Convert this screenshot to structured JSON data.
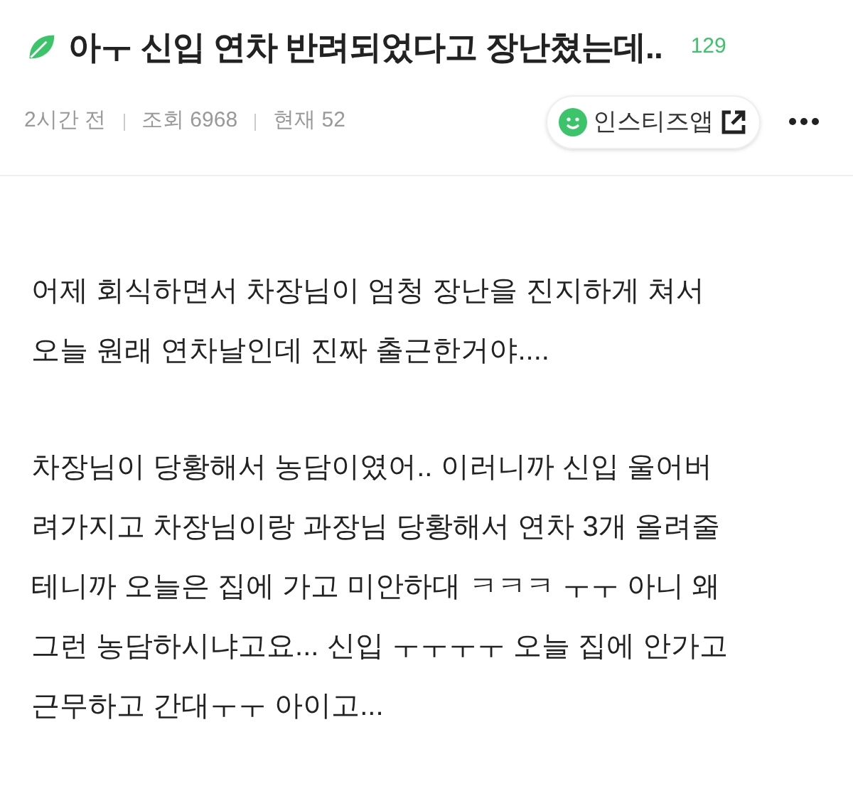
{
  "header": {
    "title": "아ㅜ 신입 연차 반려되었다고 장난쳤는데..",
    "comment_count": "129",
    "time": "2시간 전",
    "views": "조회 6968",
    "current": "현재 52",
    "app_button": "인스티즈앱"
  },
  "paragraphs": [
    {
      "lines": [
        "어제 회식하면서 차장님이 엄청 장난을 진지하게 쳐서",
        "오늘 원래 연차날인데 진짜 출근한거야...."
      ]
    },
    {
      "lines": [
        "차장님이 당황해서 농담이였어.. 이러니까 신입 울어버",
        "려가지고 차장님이랑 과장님 당황해서 연차 3개 올려줄",
        "테니까 오늘은 집에 가고 미안하대 ㅋㅋㅋ ㅜㅜ 아니 왜",
        "그런 농담하시냐고요... 신입 ㅜㅜㅜㅜ 오늘 집에 안가고",
        "근무하고 간대ㅜㅜ 아이고..."
      ]
    }
  ]
}
